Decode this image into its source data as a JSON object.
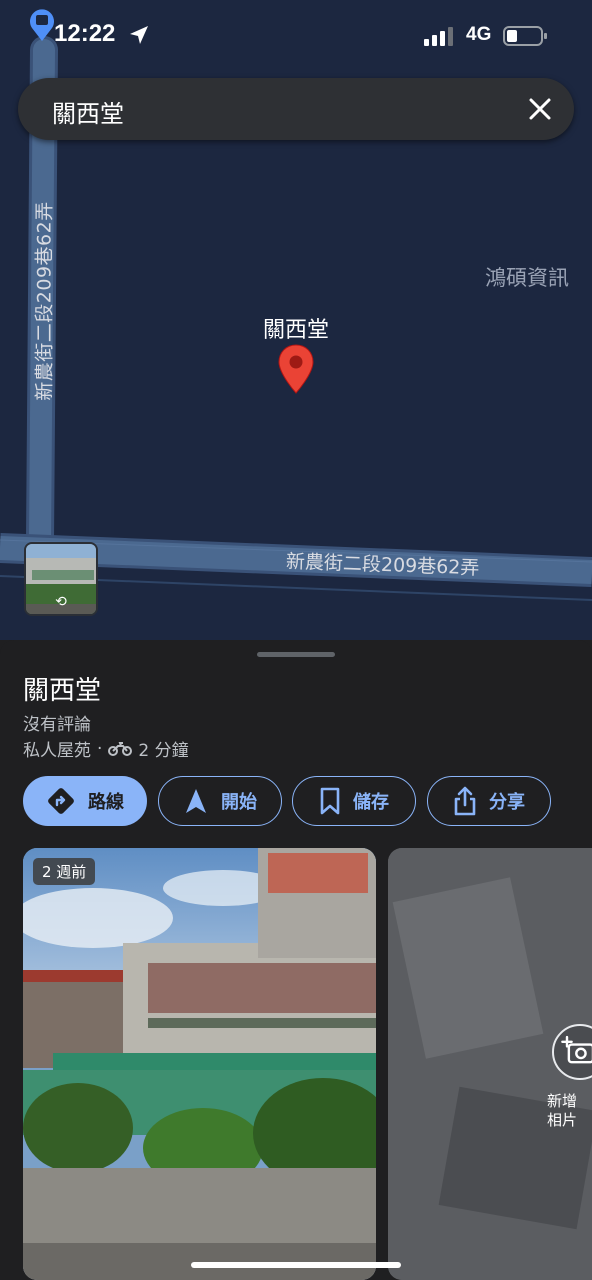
{
  "status_bar": {
    "time": "12:22",
    "network": "4G",
    "icons": [
      "app-badge-icon",
      "location-arrow-icon",
      "cellular-signal-icon",
      "battery-icon"
    ]
  },
  "search": {
    "query": "關西堂",
    "clear_icon": "close-icon"
  },
  "map": {
    "road_vertical": "新農街二段209巷62弄",
    "road_horizontal": "新農街二段209巷62弄",
    "poi_right": "鴻碩資訊",
    "pin_label": "關西堂",
    "pin_color": "#ea4335",
    "street_view_icon": "rotate-360-icon"
  },
  "place": {
    "name": "關西堂",
    "reviews": "沒有評論",
    "category": "私人屋苑",
    "separator": "·",
    "travel_time": "2 分鐘",
    "travel_mode_icon": "motorcycle-icon"
  },
  "actions": [
    {
      "label": "路線",
      "icon": "directions-icon",
      "primary": true
    },
    {
      "label": "開始",
      "icon": "navigation-arrow-icon",
      "primary": false
    },
    {
      "label": "儲存",
      "icon": "bookmark-icon",
      "primary": false
    },
    {
      "label": "分享",
      "icon": "share-icon",
      "primary": false
    }
  ],
  "photos": {
    "age_badge": "2 週前",
    "add_photo_label": "新增\n相片",
    "add_photo_icon": "add-photo-icon"
  },
  "colors": {
    "map_bg": "#1c2740",
    "road": "#4b6990",
    "accent": "#8ab4f8",
    "sheet_bg": "#1f1f21"
  }
}
